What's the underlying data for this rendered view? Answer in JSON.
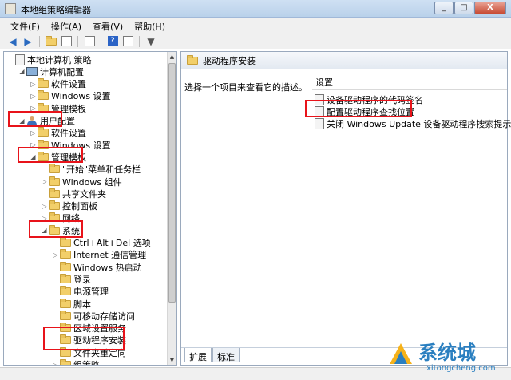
{
  "window": {
    "title": "本地组策略编辑器",
    "buttons": [
      "_",
      "□",
      "X"
    ]
  },
  "menubar": [
    "文件(F)",
    "操作(A)",
    "查看(V)",
    "帮助(H)"
  ],
  "tree": {
    "items": [
      {
        "label": "本地计算机 策略",
        "indent": 0,
        "arrow": "",
        "icon": "doc"
      },
      {
        "label": "计算机配置",
        "indent": 1,
        "arrow": "◢",
        "icon": "comp"
      },
      {
        "label": "软件设置",
        "indent": 2,
        "arrow": "▷",
        "icon": "folder"
      },
      {
        "label": "Windows 设置",
        "indent": 2,
        "arrow": "▷",
        "icon": "folder"
      },
      {
        "label": "管理模板",
        "indent": 2,
        "arrow": "▷",
        "icon": "folder"
      },
      {
        "label": "用户配置",
        "indent": 1,
        "arrow": "◢",
        "icon": "user"
      },
      {
        "label": "软件设置",
        "indent": 2,
        "arrow": "▷",
        "icon": "folder"
      },
      {
        "label": "Windows 设置",
        "indent": 2,
        "arrow": "▷",
        "icon": "folder"
      },
      {
        "label": "管理模板",
        "indent": 2,
        "arrow": "◢",
        "icon": "folder"
      },
      {
        "label": "\"开始\"菜单和任务栏",
        "indent": 3,
        "arrow": "",
        "icon": "folder"
      },
      {
        "label": "Windows 组件",
        "indent": 3,
        "arrow": "▷",
        "icon": "folder"
      },
      {
        "label": "共享文件夹",
        "indent": 3,
        "arrow": "",
        "icon": "folder"
      },
      {
        "label": "控制面板",
        "indent": 3,
        "arrow": "▷",
        "icon": "folder"
      },
      {
        "label": "网络",
        "indent": 3,
        "arrow": "▷",
        "icon": "folder"
      },
      {
        "label": "系统",
        "indent": 3,
        "arrow": "◢",
        "icon": "folder"
      },
      {
        "label": "Ctrl+Alt+Del 选项",
        "indent": 4,
        "arrow": "",
        "icon": "folder"
      },
      {
        "label": "Internet 通信管理",
        "indent": 4,
        "arrow": "▷",
        "icon": "folder"
      },
      {
        "label": "Windows 热启动",
        "indent": 4,
        "arrow": "",
        "icon": "folder"
      },
      {
        "label": "登录",
        "indent": 4,
        "arrow": "",
        "icon": "folder"
      },
      {
        "label": "电源管理",
        "indent": 4,
        "arrow": "",
        "icon": "folder"
      },
      {
        "label": "脚本",
        "indent": 4,
        "arrow": "",
        "icon": "folder"
      },
      {
        "label": "可移动存储访问",
        "indent": 4,
        "arrow": "",
        "icon": "folder"
      },
      {
        "label": "区域设置服务",
        "indent": 4,
        "arrow": "",
        "icon": "folder"
      },
      {
        "label": "驱动程序安装",
        "indent": 4,
        "arrow": "",
        "icon": "folder"
      },
      {
        "label": "文件夹重定向",
        "indent": 4,
        "arrow": "",
        "icon": "folder"
      },
      {
        "label": "组策略",
        "indent": 4,
        "arrow": "▷",
        "icon": "folder"
      }
    ]
  },
  "right": {
    "header": "驱动程序安装",
    "description": "选择一个项目来查看它的描述。",
    "column_header": "设置",
    "settings": [
      "设备驱动程序的代码签名",
      "配置驱动程序查找位置",
      "关闭 Windows Update 设备驱动程序搜索提示"
    ],
    "tabs": [
      "扩展",
      "标准"
    ]
  },
  "watermark": {
    "text": "系统城",
    "url": "xitongcheng.com"
  }
}
